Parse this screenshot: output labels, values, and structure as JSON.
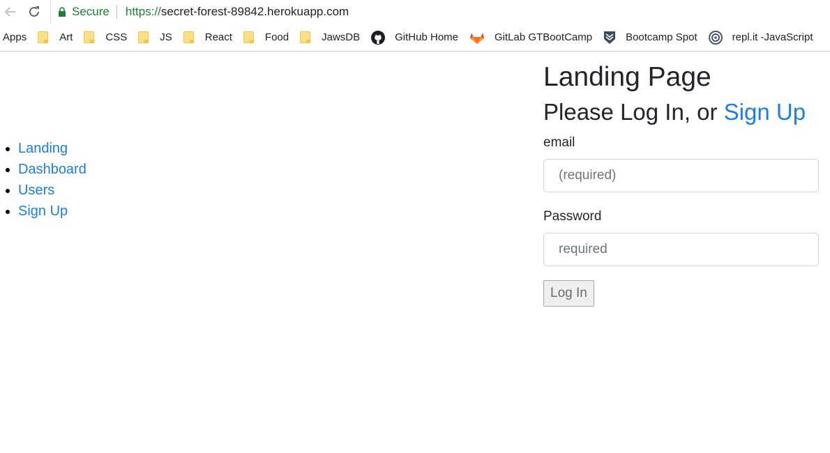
{
  "browser": {
    "secure_label": "Secure",
    "url_scheme": "https://",
    "url_host": "secret-forest-89842.herokuapp.com",
    "colors": {
      "secure_green": "#1e7e34"
    }
  },
  "bookmarks": {
    "apps_label": "Apps",
    "items": [
      {
        "label": "Art",
        "icon": "folder-icon"
      },
      {
        "label": "CSS",
        "icon": "folder-icon"
      },
      {
        "label": "JS",
        "icon": "folder-icon"
      },
      {
        "label": "React",
        "icon": "folder-icon"
      },
      {
        "label": "Food",
        "icon": "folder-icon"
      },
      {
        "label": "JawsDB",
        "icon": "folder-icon"
      },
      {
        "label": "GitHub Home",
        "icon": "github-icon"
      },
      {
        "label": "GitLab GTBootCamp",
        "icon": "gitlab-icon"
      },
      {
        "label": "Bootcamp Spot",
        "icon": "bootcamp-spot-icon"
      },
      {
        "label": "repl.it -JavaScript",
        "icon": "replit-icon"
      }
    ]
  },
  "nav": {
    "items": [
      "Landing",
      "Dashboard",
      "Users",
      "Sign Up"
    ]
  },
  "login": {
    "title": "Landing Page",
    "subtitle_prefix": "Please Log In, or ",
    "signup_link": "Sign Up",
    "email_label": "email",
    "email_placeholder": "(required)",
    "password_label": "Password",
    "password_placeholder": "required",
    "submit_label": "Log In",
    "colors": {
      "link": "#1a7ee6"
    }
  }
}
